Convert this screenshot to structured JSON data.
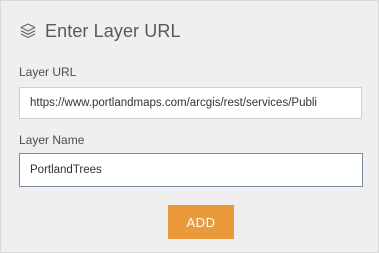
{
  "header": {
    "title": "Enter Layer URL",
    "icon": "layers-icon"
  },
  "form": {
    "url_label": "Layer URL",
    "url_value": "https://www.portlandmaps.com/arcgis/rest/services/Publi",
    "name_label": "Layer Name",
    "name_value": "PortlandTrees",
    "add_label": "ADD"
  },
  "colors": {
    "panel_bg": "#efefef",
    "accent_button": "#ea9a3a",
    "focused_border": "#7d8da3"
  }
}
